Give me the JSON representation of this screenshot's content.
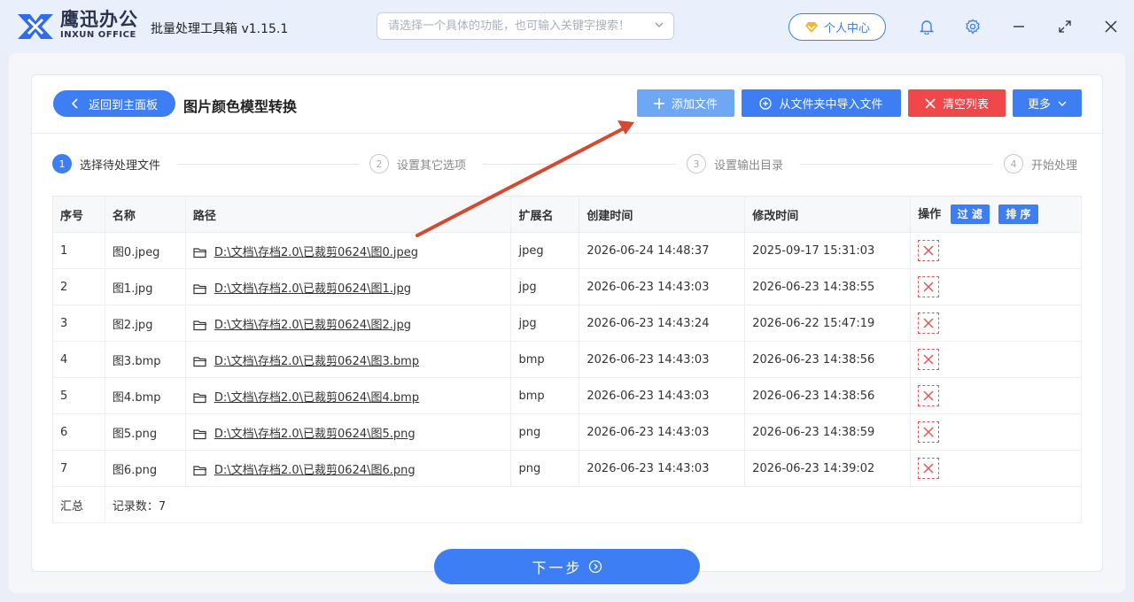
{
  "app": {
    "brand_cn": "鹰迅办公",
    "brand_en": "INXUN OFFICE",
    "title": "批量处理工具箱 v1.15.1",
    "search_placeholder": "请选择一个具体的功能，也可输入关键字搜索！",
    "user_center": "个人中心"
  },
  "page": {
    "back_label": "返回到主面板",
    "title": "图片颜色模型转换"
  },
  "toolbar": {
    "add_file": "添加文件",
    "import_folder": "从文件夹中导入文件",
    "clear_list": "清空列表",
    "more": "更多"
  },
  "steps": [
    {
      "num": "1",
      "label": "选择待处理文件"
    },
    {
      "num": "2",
      "label": "设置其它选项"
    },
    {
      "num": "3",
      "label": "设置输出目录"
    },
    {
      "num": "4",
      "label": "开始处理"
    }
  ],
  "table": {
    "headers": {
      "index": "序号",
      "name": "名称",
      "path": "路径",
      "ext": "扩展名",
      "created": "创建时间",
      "modified": "修改时间",
      "ops": "操作"
    },
    "filter_label": "过 滤",
    "sort_label": "排 序",
    "rows": [
      {
        "index": "1",
        "name": "图0.jpeg",
        "path": "D:\\文档\\存档2.0\\已裁剪0624\\图0.jpeg",
        "ext": "jpeg",
        "created": "2026-06-24 14:48:37",
        "modified": "2025-09-17 15:31:03"
      },
      {
        "index": "2",
        "name": "图1.jpg",
        "path": "D:\\文档\\存档2.0\\已裁剪0624\\图1.jpg",
        "ext": "jpg",
        "created": "2026-06-23 14:43:03",
        "modified": "2026-06-23 14:38:55"
      },
      {
        "index": "3",
        "name": "图2.jpg",
        "path": "D:\\文档\\存档2.0\\已裁剪0624\\图2.jpg",
        "ext": "jpg",
        "created": "2026-06-23 14:43:24",
        "modified": "2026-06-22 15:47:19"
      },
      {
        "index": "4",
        "name": "图3.bmp",
        "path": "D:\\文档\\存档2.0\\已裁剪0624\\图3.bmp",
        "ext": "bmp",
        "created": "2026-06-23 14:43:03",
        "modified": "2026-06-23 14:38:56"
      },
      {
        "index": "5",
        "name": "图4.bmp",
        "path": "D:\\文档\\存档2.0\\已裁剪0624\\图4.bmp",
        "ext": "bmp",
        "created": "2026-06-23 14:43:03",
        "modified": "2026-06-23 14:38:56"
      },
      {
        "index": "6",
        "name": "图5.png",
        "path": "D:\\文档\\存档2.0\\已裁剪0624\\图5.png",
        "ext": "png",
        "created": "2026-06-23 14:43:03",
        "modified": "2026-06-23 14:38:59"
      },
      {
        "index": "7",
        "name": "图6.png",
        "path": "D:\\文档\\存档2.0\\已裁剪0624\\图6.png",
        "ext": "png",
        "created": "2026-06-23 14:43:03",
        "modified": "2026-06-23 14:39:02"
      }
    ],
    "summary_label": "汇总",
    "record_count": "记录数：7"
  },
  "next_label": "下一步",
  "colors": {
    "primary": "#3d7ef5",
    "add_file_bg": "#6ea8f4",
    "danger": "#f0484a",
    "arrow": "#d4492f"
  }
}
